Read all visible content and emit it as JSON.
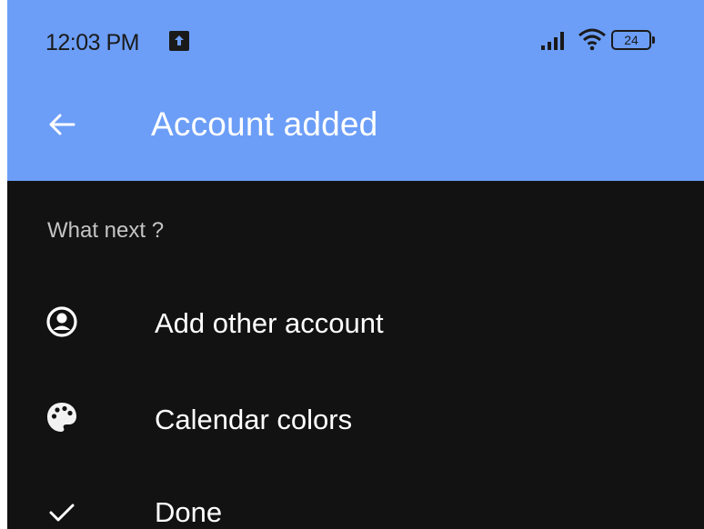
{
  "status_bar": {
    "time": "12:03 PM",
    "battery_level": "24",
    "icons": [
      "notification-icon",
      "signal-icon",
      "wifi-icon",
      "battery-icon"
    ]
  },
  "app_bar": {
    "back_icon": "arrow-back-icon",
    "title": "Account added",
    "background_color": "#6c9ef8"
  },
  "main": {
    "section_header": "What next ?",
    "items": [
      {
        "icon": "account-circle-icon",
        "label": "Add other account"
      },
      {
        "icon": "palette-icon",
        "label": "Calendar colors"
      },
      {
        "icon": "check-icon",
        "label": "Done"
      }
    ],
    "background_color": "#121212"
  }
}
